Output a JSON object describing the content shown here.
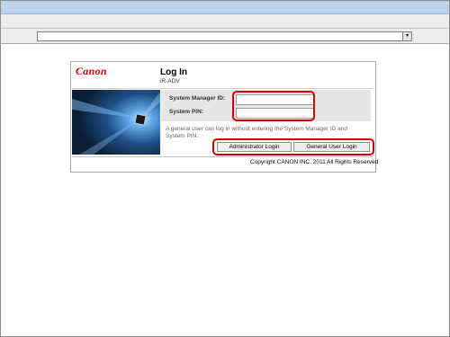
{
  "logo": {
    "text": "Canon"
  },
  "login": {
    "title": "Log In",
    "subtitle": "iR-ADV",
    "system_manager_id_label": "System Manager ID:",
    "system_pin_label": "System PIN:",
    "system_manager_id_value": "",
    "system_pin_value": "",
    "note": "A general user can log in without entering the System Manager ID and System PIN.",
    "admin_login_button": "Administrator Login",
    "general_login_button": "General User Login",
    "copyright": "Copyright CANON INC. 2011 All Rights Reserved"
  },
  "colors": {
    "brand": "#cc0000",
    "highlight": "#d20000",
    "titlebar": "#bcd3ec"
  },
  "icons": {
    "address_dropdown": "chevron-down-icon"
  }
}
